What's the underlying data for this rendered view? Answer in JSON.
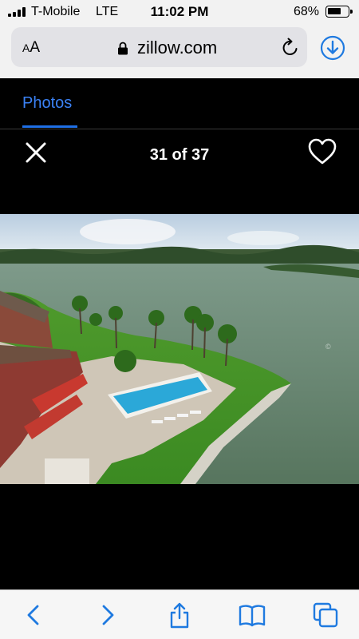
{
  "status_bar": {
    "carrier": "T-Mobile",
    "network": "LTE",
    "time": "11:02 PM",
    "battery": "68%",
    "battery_level": 0.68
  },
  "browser": {
    "text_size_label": "AA",
    "url": "zillow.com",
    "icons": [
      "lock-icon",
      "reload-icon",
      "download-icon"
    ]
  },
  "photo_viewer": {
    "tab_label": "Photos",
    "counter": "31 of 37",
    "icons": [
      "close-icon",
      "heart-icon"
    ],
    "photo_description_icon": "aerial-lake-pool-photo"
  },
  "toolbar": {
    "icons": [
      "back-icon",
      "forward-icon",
      "share-icon",
      "bookmarks-icon",
      "tabs-icon"
    ]
  },
  "colors": {
    "accent": "#1f7ae0",
    "tab_active": "#3b82f6",
    "viewer_background": "#000000",
    "chrome_background": "#f2f2f2"
  }
}
